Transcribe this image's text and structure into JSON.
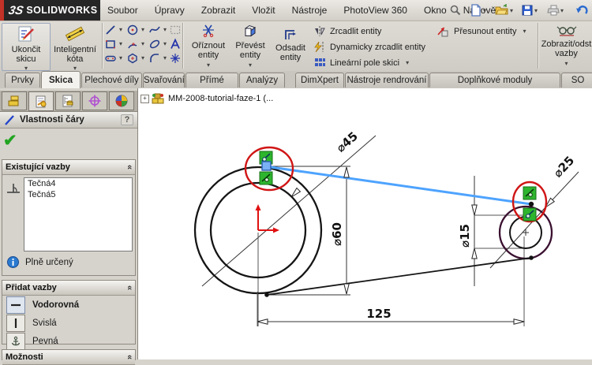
{
  "titlebar": {
    "logo_mark": "3S",
    "logo_name": "SOLIDWORKS",
    "menus": [
      "Soubor",
      "Úpravy",
      "Zobrazit",
      "Vložit",
      "Nástroje",
      "PhotoView 360",
      "Okno",
      "Nápověda"
    ]
  },
  "toolbar": {
    "exit_sketch": [
      "Ukončit",
      "skicu"
    ],
    "smart_dimension": [
      "Inteligentní",
      "kóta"
    ],
    "trim": [
      "Oříznout",
      "entity"
    ],
    "convert": [
      "Převést",
      "entity"
    ],
    "offset": [
      "Odsadit",
      "entity"
    ],
    "mirror": "Zrcadlit entity",
    "dynamic_mirror": "Dynamicky zrcadlit entity",
    "linear_pattern": "Lineární pole skici",
    "move": "Přesunout entity",
    "show_relations": [
      "Zobrazit/odst",
      "vazby"
    ]
  },
  "tabs": [
    "Prvky",
    "Skica",
    "Plechové díly",
    "Svařování",
    "Přímé úpravy",
    "Analýzy",
    "DimXpert",
    "Nástroje rendrování",
    "Doplňkové moduly SOLIDWORKS",
    "SO"
  ],
  "active_tab": "Skica",
  "panel": {
    "title": "Vlastnosti čáry",
    "help": "?",
    "existing_relations": {
      "title": "Existující vazby",
      "items": [
        "Tečná4",
        "Tečná5"
      ]
    },
    "status": "Plně určený",
    "add_relations": {
      "title": "Přidat vazby",
      "items": [
        "Vodorovná",
        "Svislá",
        "Pevná"
      ]
    },
    "options_title": "Možnosti"
  },
  "canvas": {
    "feature_tree_node": "MM-2008-tutorial-faze-1 (...",
    "dims": {
      "d45": "⌀45",
      "d60": "⌀60",
      "d25": "⌀25",
      "d15": "⌀15",
      "length": "125"
    }
  },
  "colors": {
    "selection_blue": "#4da3ff",
    "relation_green": "#2eb52e",
    "highlight_red": "#d01515",
    "fixed_maroon": "#3a1030"
  }
}
